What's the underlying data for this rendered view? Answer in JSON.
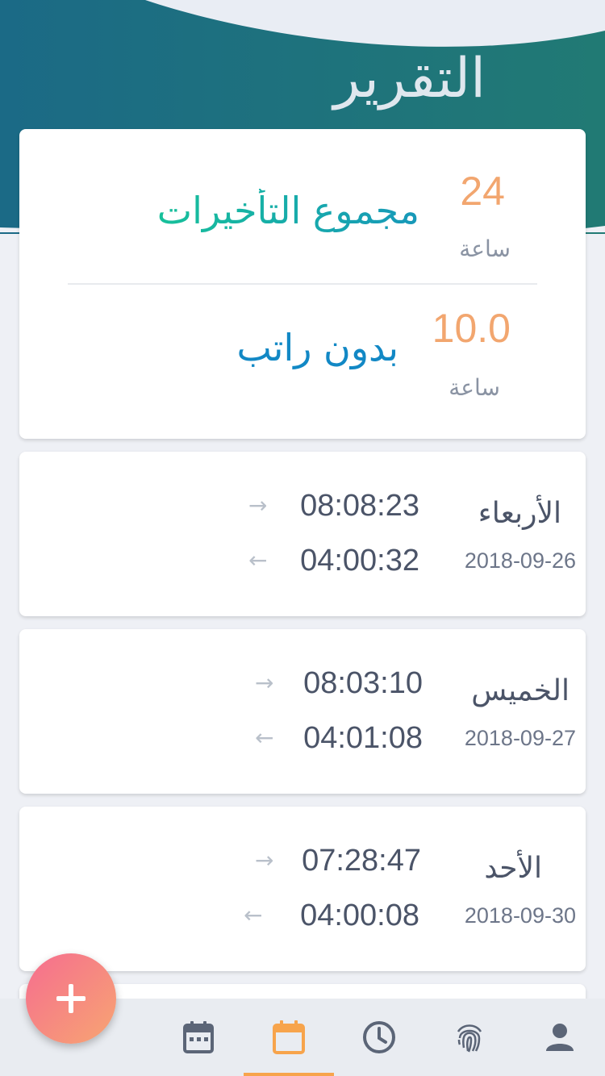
{
  "header": {
    "title": "التقرير",
    "colors": {
      "wave_dark": "#1b6f87",
      "wave_light": "#1f7a75",
      "accent": "#f2a66f"
    }
  },
  "summary": {
    "delays": {
      "value": "24",
      "unit": "ساعة",
      "label": "مجموع التأخيرات"
    },
    "unpaid": {
      "value": "10.0",
      "unit": "ساعة",
      "label": "بدون راتب"
    }
  },
  "days": [
    {
      "day": "الأربعاء",
      "date": "2018-09-26",
      "time_in": "08:08:23",
      "time_out": "04:00:32"
    },
    {
      "day": "الخميس",
      "date": "2018-09-27",
      "time_in": "08:03:10",
      "time_out": "04:01:08"
    },
    {
      "day": "الأحد",
      "date": "2018-09-30",
      "time_in": "07:28:47",
      "time_out": "04:00:08"
    }
  ],
  "fab": {
    "icon": "plus-icon"
  },
  "nav": {
    "items": [
      {
        "icon": "calendar-dots-icon",
        "active": false
      },
      {
        "icon": "calendar-icon",
        "active": true
      },
      {
        "icon": "clock-icon",
        "active": false
      },
      {
        "icon": "fingerprint-icon",
        "active": false
      },
      {
        "icon": "user-icon",
        "active": false
      }
    ],
    "active_color": "#f7a44c",
    "inactive_color": "#5b6577"
  }
}
